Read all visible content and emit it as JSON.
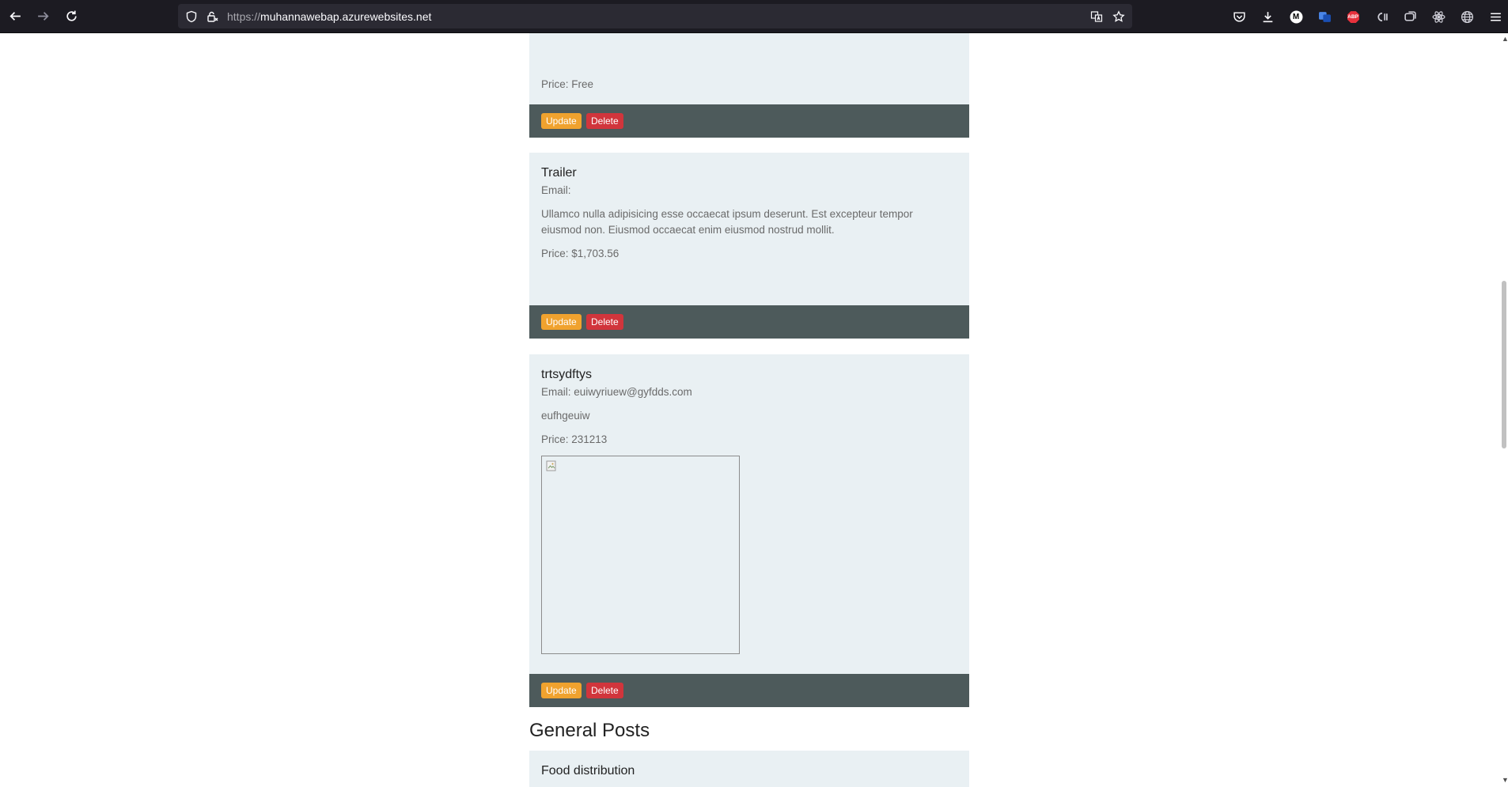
{
  "browser": {
    "url_prefix": "https://",
    "url_host": "muhannawebap.azurewebsites.net",
    "ext_badges": {
      "medium": "M",
      "abp": "ABP"
    }
  },
  "posts": [
    {
      "title": "",
      "email": "",
      "description": "",
      "price": "Price: Free",
      "update_label": "Update",
      "delete_label": "Delete"
    },
    {
      "title": "Trailer",
      "email": "Email:",
      "description": "Ullamco nulla adipisicing esse occaecat ipsum deserunt. Est excepteur tempor eiusmod non. Eiusmod occaecat enim eiusmod nostrud mollit.",
      "price": "Price: $1,703.56",
      "update_label": "Update",
      "delete_label": "Delete"
    },
    {
      "title": "trtsydftys",
      "email": "Email: euiwyriuew@gyfdds.com",
      "description": "eufhgeuiw",
      "price": "Price: 231213",
      "update_label": "Update",
      "delete_label": "Delete"
    }
  ],
  "general_section": {
    "heading": "General Posts",
    "first_post_title": "Food distribution"
  },
  "colors": {
    "update_button": "#f0a22e",
    "delete_button": "#d1353c",
    "card_background": "#e9f0f3",
    "card_footer": "#4d5a5b"
  }
}
